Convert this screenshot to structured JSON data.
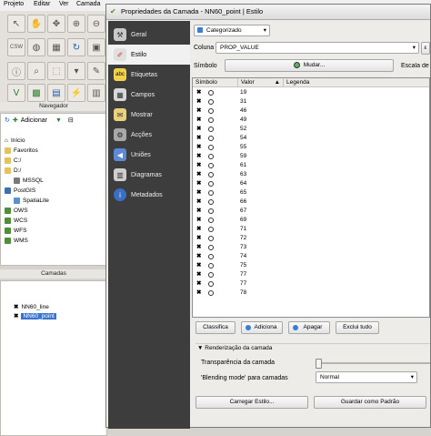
{
  "menubar": [
    "Projeto",
    "Editar",
    "Ver",
    "Camada"
  ],
  "browser": {
    "title": "Navegador",
    "add_label": "Adicionar",
    "items": [
      "Início",
      "Favoritos",
      "C:/",
      "D:/",
      "MSSQL",
      "PostGIS",
      "SpatiaLite",
      "OWS",
      "WCS",
      "WFS",
      "WMS"
    ]
  },
  "layers": {
    "title": "Camadas",
    "items": [
      "NN60_line",
      "NN60_point"
    ]
  },
  "dialog": {
    "title": "Propriedades da Camada - NN60_point | Estilo",
    "sidebar": [
      "Geral",
      "Estilo",
      "Etiquetas",
      "Campos",
      "Mostrar",
      "Acções",
      "Uniões",
      "Diagramas",
      "Metadados"
    ],
    "active_tab": "Estilo",
    "renderer": "Categorizado",
    "column_label": "Coluna",
    "column_value": "PROP_VALUE",
    "symbol_label": "Símbolo",
    "change_label": "Mudar...",
    "color_scale_label": "Escala de c",
    "table_headers": [
      "Símbolo",
      "Valor",
      "Legenda"
    ],
    "values": [
      "19",
      "31",
      "46",
      "49",
      "52",
      "54",
      "55",
      "59",
      "61",
      "63",
      "64",
      "65",
      "66",
      "67",
      "69",
      "71",
      "72",
      "73",
      "74",
      "75",
      "77",
      "77",
      "78"
    ],
    "buttons": [
      "Classifica",
      "Adiciona",
      "Apagar",
      "Exclui tudo"
    ],
    "render_section": "Renderização da camada",
    "transparency_label": "Transparência da camada",
    "blending_label": "'Blending mode' para camadas",
    "blending_value": "Normal",
    "load_style": "Carregar Estilo...",
    "save_default": "Guardar como Padrão"
  }
}
